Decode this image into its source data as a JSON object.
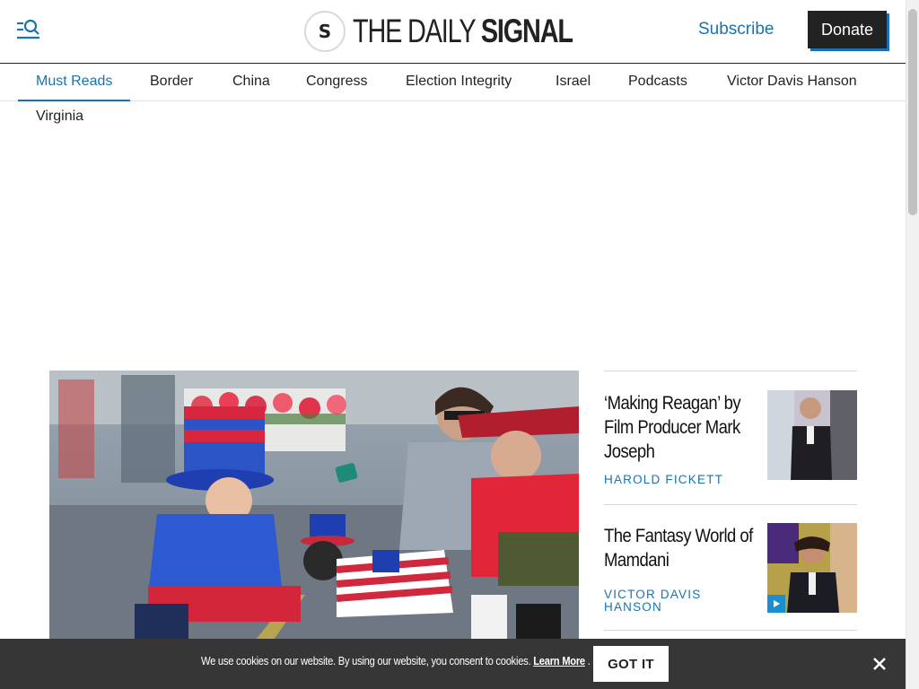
{
  "header": {
    "logo_mark": "S",
    "logo_text_thin": "THE DAILY ",
    "logo_text_bold": "SIGNAL",
    "subscribe_label": "Subscribe",
    "donate_label": "Donate"
  },
  "nav": {
    "items": [
      "Must Reads",
      "Border",
      "China",
      "Congress",
      "Election Integrity",
      "Israel",
      "Podcasts",
      "Victor Davis Hanson",
      "Virginia"
    ],
    "active": "Must Reads"
  },
  "sidebar": {
    "stories": [
      {
        "title": "‘Making Reagan’ by Film Producer Mark Joseph",
        "author": "HAROLD FICKETT",
        "has_video": false
      },
      {
        "title": "The Fantasy World of Mamdani",
        "author": "VICTOR DAVIS HANSON",
        "has_video": true
      }
    ]
  },
  "cookie": {
    "text": "We use cookies on our website. By using our website, you consent to cookies.",
    "link": "Learn More",
    "period": ".",
    "button": "GOT IT"
  },
  "colors": {
    "accent": "#1a73b0",
    "dark": "#222222",
    "cookie_bg": "#363636"
  },
  "icons": {
    "menu": "search-menu-icon",
    "close": "close-icon",
    "play": "play-icon"
  }
}
